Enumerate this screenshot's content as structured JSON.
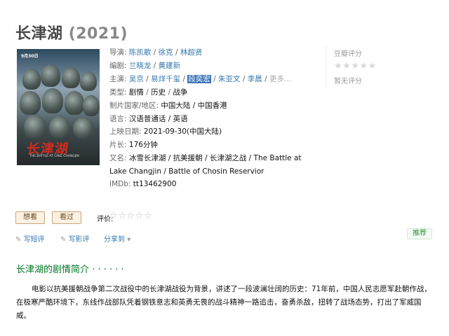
{
  "title": {
    "name": "长津湖",
    "year": "(2021)"
  },
  "poster": {
    "date_badge": "9月30日",
    "title_text": "长津湖",
    "subtitle": "THE BATTLE AT LAKE CHANGJIN"
  },
  "info": {
    "director_label": "导演:",
    "directors": [
      "陈凯歌",
      "徐克",
      "林超贤"
    ],
    "writer_label": "编剧:",
    "writers": [
      "兰晓龙",
      "黄建新"
    ],
    "cast_label": "主演:",
    "cast": [
      "吴京",
      "易烊千玺",
      "段奕宏",
      "朱亚文",
      "李晨"
    ],
    "cast_more": "更多...",
    "genre_label": "类型:",
    "genres": [
      "剧情",
      "历史",
      "战争"
    ],
    "region_label": "制片国家/地区:",
    "region": "中国大陆 / 中国香港",
    "language_label": "语言:",
    "language": "汉语普通话 / 英语",
    "release_label": "上映日期:",
    "release": "2021-09-30(中国大陆)",
    "runtime_label": "片长:",
    "runtime": "176分钟",
    "aka_label": "又名:",
    "aka_line1": "冰雪长津湖 / 抗美援朝 / 长津湖之战 / The Battle at",
    "aka_line2": "Lake Changjin / Battle of Chosin Reservior",
    "imdb_label": "IMDb:",
    "imdb": "tt13462900"
  },
  "rating": {
    "label": "豆瓣评分",
    "stars": "★★★★★",
    "none_text": "暂无评分"
  },
  "actions": {
    "want_label": "想看",
    "seen_label": "看过",
    "rate_label": "评价:",
    "rate_stars": "☆☆☆☆☆"
  },
  "tools": {
    "short_review": "写短评",
    "review": "写影评",
    "share": "分享到",
    "share_caret": "▾",
    "recommend": "推荐"
  },
  "summary": {
    "heading": "长津湖的剧情简介 · · · · · ·",
    "text": "电影以抗美援朝战争第二次战役中的长津湖战役为背景，讲述了一段波澜壮阔的历史：71年前，中国人民志愿军赴朝作战，在极寒严酷环境下，东线作战部队凭着钢铁意志和英勇无畏的战斗精神一路追击，奋勇杀敌，扭转了战场态势，打出了军威国威。"
  },
  "colors": {
    "link": "#3377aa",
    "heading_green": "#007722",
    "highlight": "#3b73b9",
    "button_bg": "#fdf1e2"
  }
}
